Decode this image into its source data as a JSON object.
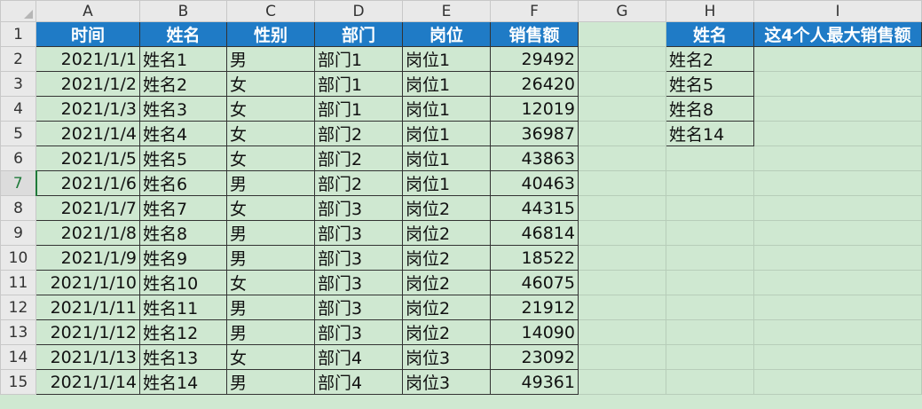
{
  "columns": [
    "A",
    "B",
    "C",
    "D",
    "E",
    "F",
    "G",
    "H",
    "I"
  ],
  "row_numbers": [
    "1",
    "2",
    "3",
    "4",
    "5",
    "6",
    "7",
    "8",
    "9",
    "10",
    "11",
    "12",
    "13",
    "14",
    "15"
  ],
  "main_headers": [
    "时间",
    "姓名",
    "性别",
    "部门",
    "岗位",
    "销售额"
  ],
  "rows": [
    [
      "2021/1/1",
      "姓名1",
      "男",
      "部门1",
      "岗位1",
      "29492"
    ],
    [
      "2021/1/2",
      "姓名2",
      "女",
      "部门1",
      "岗位1",
      "26420"
    ],
    [
      "2021/1/3",
      "姓名3",
      "女",
      "部门1",
      "岗位1",
      "12019"
    ],
    [
      "2021/1/4",
      "姓名4",
      "女",
      "部门2",
      "岗位1",
      "36987"
    ],
    [
      "2021/1/5",
      "姓名5",
      "女",
      "部门2",
      "岗位1",
      "43863"
    ],
    [
      "2021/1/6",
      "姓名6",
      "男",
      "部门2",
      "岗位1",
      "40463"
    ],
    [
      "2021/1/7",
      "姓名7",
      "女",
      "部门3",
      "岗位2",
      "44315"
    ],
    [
      "2021/1/8",
      "姓名8",
      "男",
      "部门3",
      "岗位2",
      "46814"
    ],
    [
      "2021/1/9",
      "姓名9",
      "男",
      "部门3",
      "岗位2",
      "18522"
    ],
    [
      "2021/1/10",
      "姓名10",
      "女",
      "部门3",
      "岗位2",
      "46075"
    ],
    [
      "2021/1/11",
      "姓名11",
      "男",
      "部门3",
      "岗位2",
      "21912"
    ],
    [
      "2021/1/12",
      "姓名12",
      "男",
      "部门3",
      "岗位2",
      "14090"
    ],
    [
      "2021/1/13",
      "姓名13",
      "女",
      "部门4",
      "岗位3",
      "23092"
    ],
    [
      "2021/1/14",
      "姓名14",
      "男",
      "部门4",
      "岗位3",
      "49361"
    ]
  ],
  "lookup": {
    "header_name": "姓名",
    "header_result": "这4个人最大销售额",
    "names": [
      "姓名2",
      "姓名5",
      "姓名8",
      "姓名14"
    ]
  },
  "colors": {
    "header_blue": "#1f7bc6",
    "cell_green": "#cfe8d1"
  }
}
